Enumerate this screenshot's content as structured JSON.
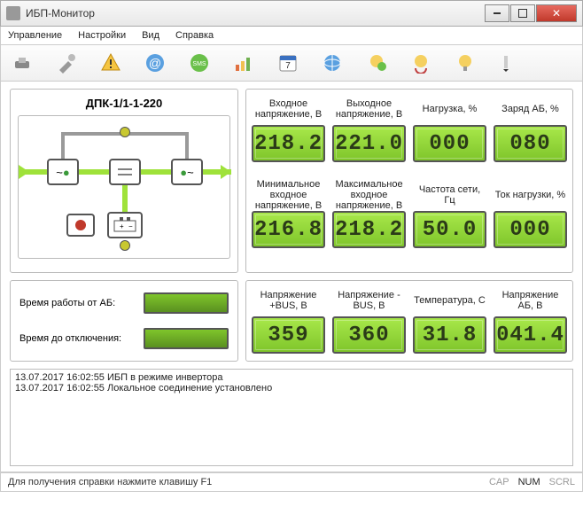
{
  "window": {
    "title": "ИБП-Монитор"
  },
  "menu": {
    "control": "Управление",
    "settings": "Настройки",
    "view": "Вид",
    "help": "Справка"
  },
  "device": {
    "name": "ДПК-1/1-1-220"
  },
  "metrics": {
    "inputVoltage": {
      "label": "Входное напряжение, В",
      "value": "218.2"
    },
    "outputVoltage": {
      "label": "Выходное напряжение, В",
      "value": "221.0"
    },
    "load": {
      "label": "Нагрузка, %",
      "value": "000"
    },
    "batteryCharge": {
      "label": "Заряд АБ, %",
      "value": "080"
    },
    "minInput": {
      "label": "Минимальное входное напряжение, В",
      "value": "216.8"
    },
    "maxInput": {
      "label": "Максимальное входное напряжение, В",
      "value": "218.2"
    },
    "frequency": {
      "label": "Частота сети, Гц",
      "value": "50.0"
    },
    "loadCurrent": {
      "label": "Ток нагрузки, %",
      "value": "000"
    },
    "busPos": {
      "label": "Напряжение +BUS, В",
      "value": "359"
    },
    "busNeg": {
      "label": "Напряжение -BUS, В",
      "value": "360"
    },
    "temperature": {
      "label": "Температура, С",
      "value": "31.8"
    },
    "batteryVoltage": {
      "label": "Напряжение АБ, В",
      "value": "041.4"
    }
  },
  "runtime": {
    "onBatteryLabel": "Время работы от АБ:",
    "toShutdownLabel": "Время до отключения:"
  },
  "log": [
    "13.07.2017 16:02:55 ИБП в режиме инвертора",
    "13.07.2017 16:02:55 Локальное соединение установлено"
  ],
  "statusbar": {
    "hint": "Для получения справки нажмите клавишу F1",
    "cap": "CAP",
    "num": "NUM",
    "scrl": "SCRL"
  }
}
